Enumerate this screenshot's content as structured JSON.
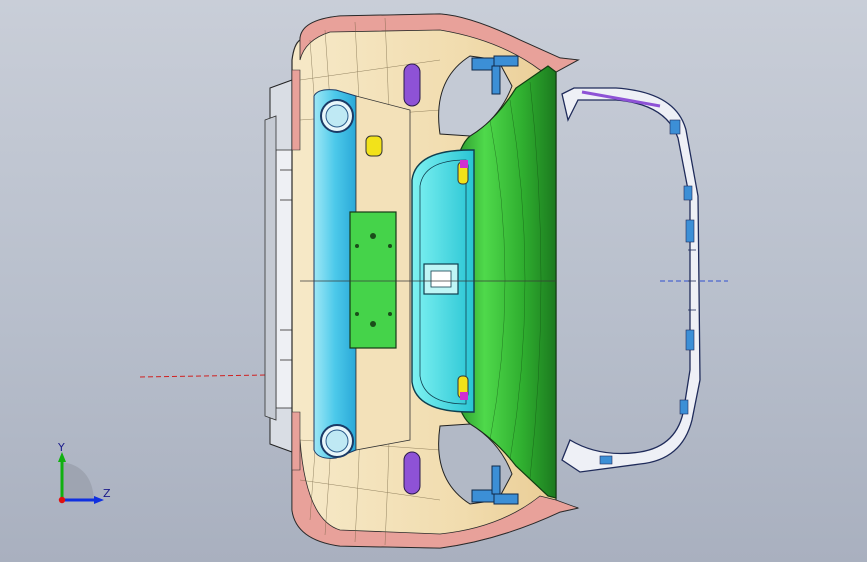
{
  "viewport": {
    "background_top": "#c9ced8",
    "background_bottom": "#a9b0bf"
  },
  "triad": {
    "y_label": "Y",
    "z_label": "Z",
    "x_color": "#e01010",
    "y_color": "#10b010",
    "z_color": "#1030e0"
  },
  "model": {
    "colors": {
      "outer_shell": "#f1dfb5",
      "shell_edge": "#e8a19a",
      "inner_panel": "#5fd4ec",
      "center_window": "#4ee1e6",
      "tailgate": "#2ea52e",
      "plate": "#45d34a",
      "lamp_purple": "#8e52d6",
      "bracket_blue": "#3c8fd6",
      "frame_edge": "#1f2b5a"
    }
  }
}
